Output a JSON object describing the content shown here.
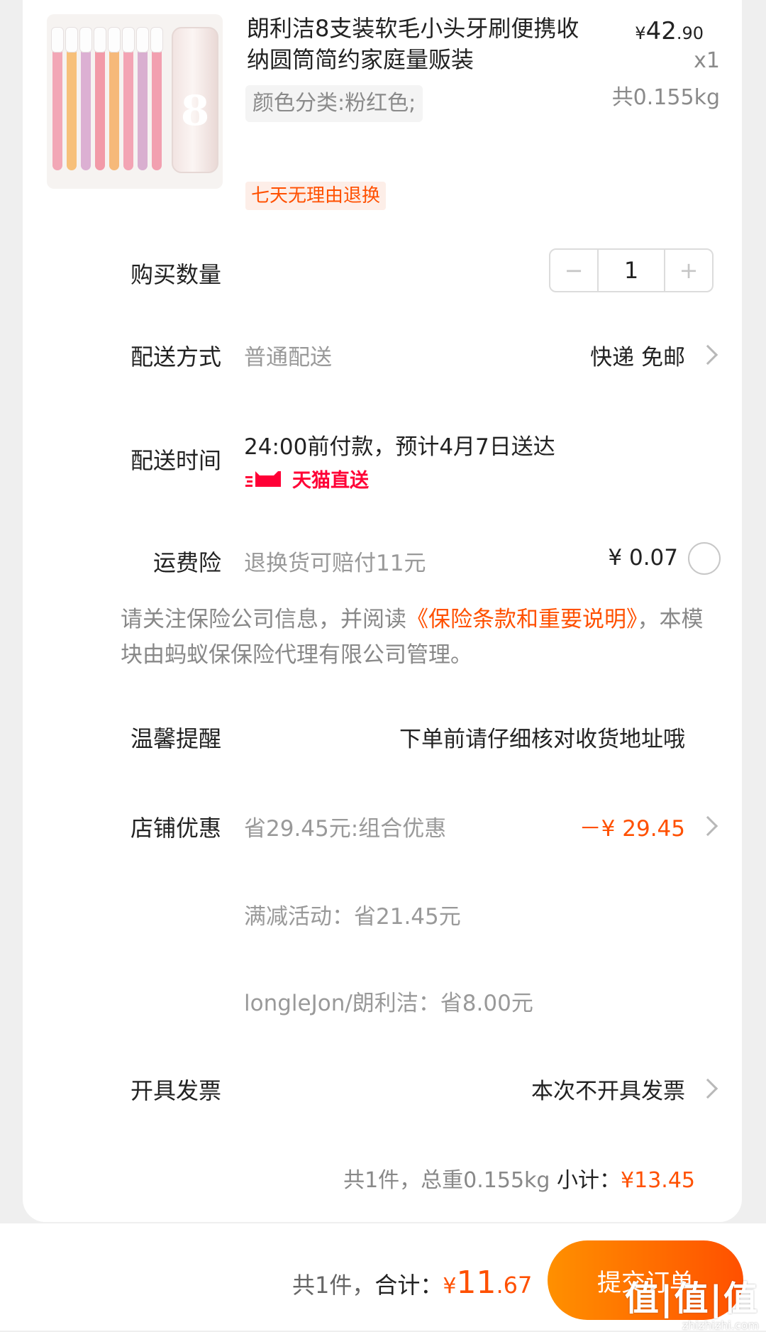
{
  "product": {
    "title": "朗利洁8支装软毛小头牙刷便携收纳圆筒简约家庭量贩装",
    "spec": "颜色分类:粉红色;",
    "price_yen": "¥",
    "price_int": "42",
    "price_dec": ".90",
    "quantity": "x1",
    "weight": "共0.155kg",
    "return_badge": "七天无理由退换",
    "image_number": "8"
  },
  "purchase_qty": {
    "label": "购买数量",
    "minus": "−",
    "value": "1",
    "plus": "+"
  },
  "delivery_method": {
    "label": "配送方式",
    "value": "普通配送",
    "right": "快递 免邮"
  },
  "delivery_time": {
    "label": "配送时间",
    "value": "24:00前付款，预计4月7日送达",
    "badge": "天猫直送"
  },
  "shipping_insurance": {
    "label": "运费险",
    "value": "退换货可赔付11元",
    "price": "¥ 0.07"
  },
  "insurance_notice": {
    "prefix": "请关注保险公司信息，并阅读",
    "link": "《保险条款和重要说明》",
    "suffix": "，本模块由蚂蚁保保险代理有限公司管理。"
  },
  "tip": {
    "label": "温馨提醒",
    "value": "下单前请仔细核对收货地址哦"
  },
  "store_discount": {
    "label": "店铺优惠",
    "value": "省29.45元:组合优惠",
    "amount": "－¥ 29.45",
    "sub1": "满减活动：省21.45元",
    "sub2": "longleJon/朗利洁：省8.00元"
  },
  "invoice": {
    "label": "开具发票",
    "value": "本次不开具发票"
  },
  "subtotal": {
    "summary": "共1件，总重0.155kg",
    "label": "小计：",
    "yen": "¥",
    "amount": "13.45"
  },
  "footer": {
    "count": "共1件，",
    "total_label": "合计：",
    "yen": "¥",
    "int": "11",
    "dec": ".67",
    "submit": "提交订单"
  },
  "watermark": {
    "main": "值|值|值",
    "url": "zhizhizhi.com"
  },
  "colors": {
    "accent": "#ff5000",
    "tmall": "#ff0036",
    "gray_text": "#999999"
  }
}
